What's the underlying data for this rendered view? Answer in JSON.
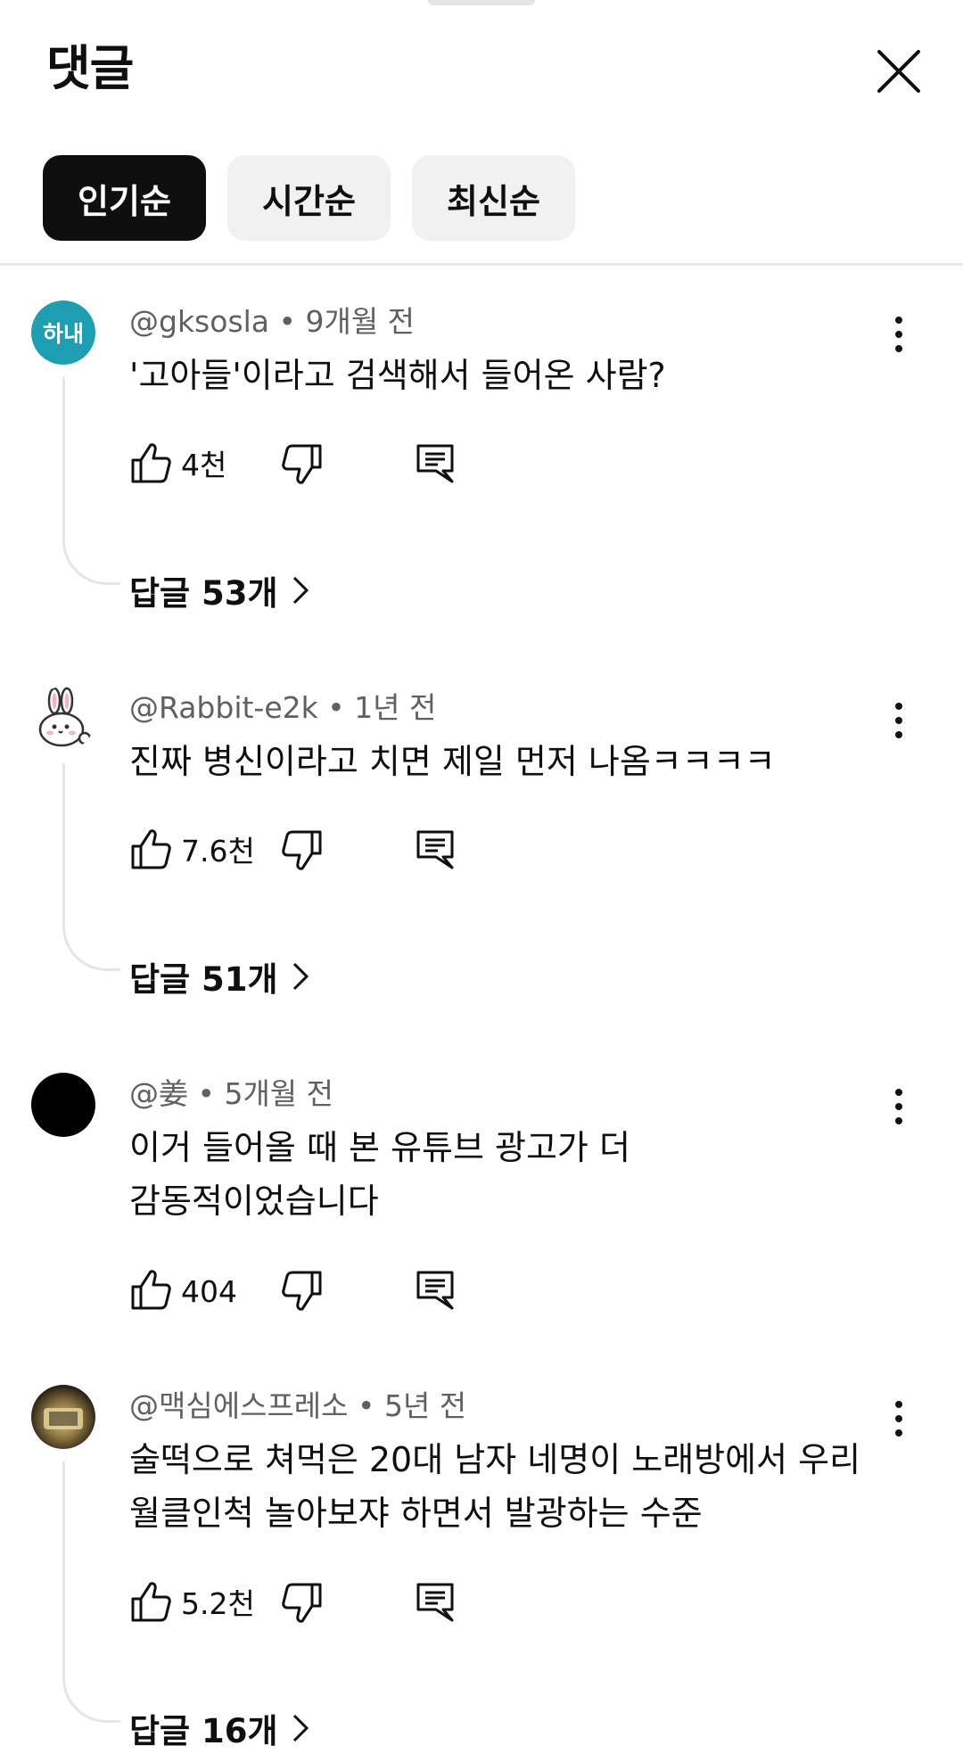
{
  "header": {
    "title": "댓글"
  },
  "sort_chips": [
    {
      "label": "인기순",
      "selected": true
    },
    {
      "label": "시간순",
      "selected": false
    },
    {
      "label": "최신순",
      "selected": false
    }
  ],
  "comments": [
    {
      "avatar_text": "하내",
      "avatar_color": "#1e9eb0",
      "author": "@gksosla",
      "time": "9개월 전",
      "meta": "@gksosla • 9개월 전",
      "text": "'고아들'이라고 검색해서 들어온 사람?",
      "likes": "4천",
      "replies": "답글 53개"
    },
    {
      "avatar_icon": "rabbit-avatar-icon",
      "author": "@Rabbit-e2k",
      "time": "1년 전",
      "meta": "@Rabbit-e2k • 1년 전",
      "text": "진짜 병신이라고 치면 제일 먼저 나옴ㅋㅋㅋㅋ",
      "likes": "7.6천",
      "replies": "답글 51개"
    },
    {
      "avatar_color": "#000000",
      "author": "@姜",
      "time": "5개월 전",
      "meta": "@姜 • 5개월 전",
      "text_lines": [
        "이거 들어올 때 본 유튜브 광고가 더",
        "감동적이었습니다"
      ],
      "likes": "404"
    },
    {
      "avatar_icon": "photo-avatar",
      "author": "@맥심에스프레소",
      "time": "5년 전",
      "meta": "@맥심에스프레소 • 5년 전",
      "text_lines": [
        "술떡으로 쳐먹은 20대 남자 네명이 노래방에서 우리",
        "월클인척 놀아보쟈 하면서 발광하는 수준"
      ],
      "likes": "5.2천",
      "replies": "답글 16개"
    }
  ],
  "icons": {
    "close": "close-icon",
    "like": "thumbs-up-icon",
    "dislike": "thumbs-down-icon",
    "reply": "reply-comment-icon",
    "more": "more-vertical-icon",
    "chevron": "chevron-right-icon"
  }
}
